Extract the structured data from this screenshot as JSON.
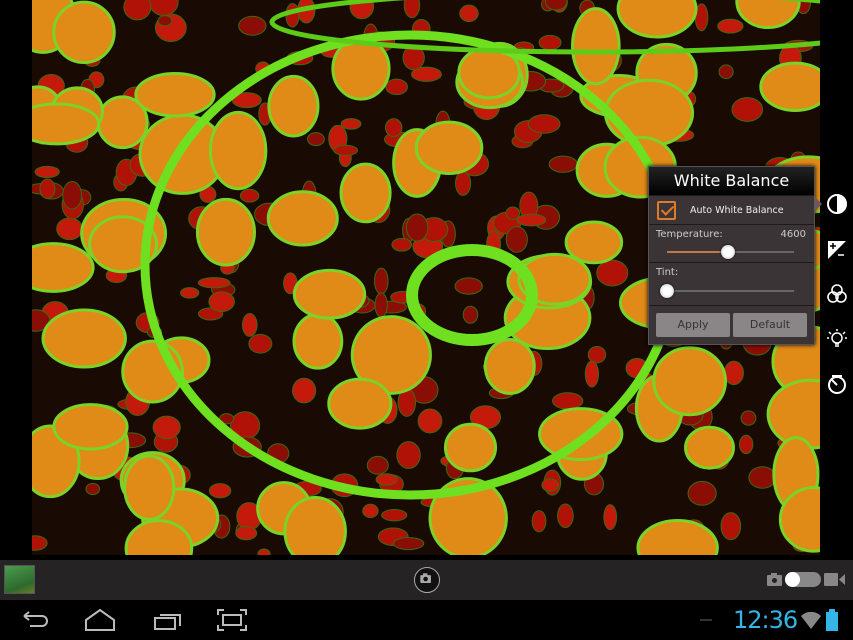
{
  "white_balance": {
    "title": "White Balance",
    "auto_label": "Auto White Balance",
    "auto_checked": true,
    "temperature_label": "Temperature:",
    "temperature_value": "4600",
    "temperature_fraction": 0.48,
    "tint_label": "Tint:",
    "tint_fraction": 0.0,
    "apply_label": "Apply",
    "default_label": "Default"
  },
  "sidebar": {
    "icons": [
      "contrast-icon",
      "exposure-icon",
      "color-channels-icon",
      "brightness-icon",
      "timer-icon"
    ],
    "active": "contrast-icon"
  },
  "status": {
    "time": "12:36"
  },
  "colors": {
    "accent": "#33b5e5",
    "checkbox": "#e07b2a"
  }
}
